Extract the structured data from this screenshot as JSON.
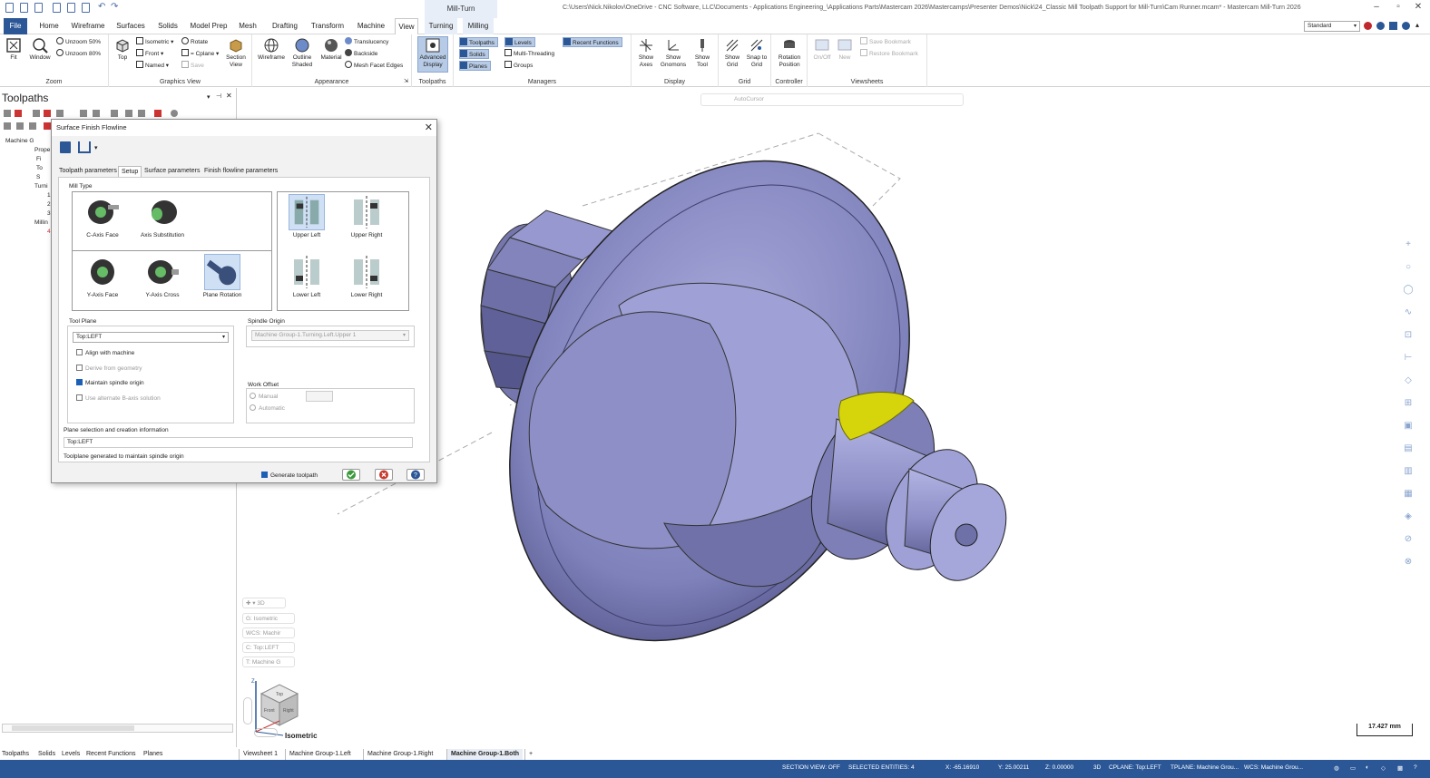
{
  "window": {
    "context_tab_label": "Mill-Turn",
    "title": "C:\\Users\\Nick.Nikolov\\OneDrive - CNC Software, LLC\\Documents - Applications Engineering_\\Applications Parts\\Mastercam 2026\\Mastercamps\\Presenter Demos\\Nick\\24_Classic Mill Toolpath Support for Mill-Turn\\Cam Runner.mcam* - Mastercam Mill-Turn 2026",
    "workspace": "Standard"
  },
  "ribbon_tabs": [
    "File",
    "Home",
    "Wireframe",
    "Surfaces",
    "Solids",
    "Model Prep",
    "Mesh",
    "Drafting",
    "Transform",
    "Machine",
    "View",
    "Turning",
    "Milling"
  ],
  "ribbon": {
    "zoom": {
      "label": "Zoom",
      "fit": "Fit",
      "window": "Window",
      "unzoom50": "Unzoom 50%",
      "unzoom80": "Unzoom 80%"
    },
    "graphics_view": {
      "label": "Graphics View",
      "top": "Top",
      "isometric": "Isometric",
      "front": "Front",
      "named": "Named",
      "rotate": "Rotate",
      "cplane": "= Cplane",
      "save": "Save",
      "section_view": "Section View"
    },
    "appearance": {
      "label": "Appearance",
      "wireframe": "Wireframe",
      "outline_shaded": "Outline Shaded",
      "material": "Material",
      "translucency": "Translucency",
      "backside": "Backside",
      "mesh_facet_edges": "Mesh Facet Edges"
    },
    "toolpaths": {
      "label": "Toolpaths",
      "advanced_display": "Advanced Display"
    },
    "managers": {
      "label": "Managers",
      "toolpaths": "Toolpaths",
      "solids": "Solids",
      "planes": "Planes",
      "levels": "Levels",
      "multi_threading": "Multi-Threading",
      "groups": "Groups",
      "recent_functions": "Recent Functions"
    },
    "display": {
      "label": "Display",
      "show_axes": "Show Axes",
      "show_gnomons": "Show Gnomons",
      "show_tool": "Show Tool"
    },
    "grid": {
      "label": "Grid",
      "show_grid": "Show Grid",
      "snap_to_grid": "Snap to Grid"
    },
    "controller": {
      "label": "Controller",
      "rotation_position": "Rotation Position"
    },
    "viewsheets": {
      "label": "Viewsheets",
      "onoff": "On/Off",
      "new": "New",
      "save_bookmark": "Save Bookmark",
      "restore_bookmark": "Restore Bookmark"
    }
  },
  "left_panel": {
    "title": "Toolpaths",
    "tree": [
      "Machine G",
      "Prope",
      "Fi",
      "To",
      "S",
      "Turni",
      "1",
      "2",
      "3",
      "Millin",
      "4"
    ]
  },
  "dialog": {
    "title": "Surface Finish Flowline",
    "tabs": [
      "Toolpath parameters",
      "Setup",
      "Surface parameters",
      "Finish flowline parameters"
    ],
    "active_tab": "Setup",
    "mill_type_label": "Mill Type",
    "mill_types": [
      "C-Axis Face",
      "Axis Substitution",
      "Y-Axis Face",
      "Y-Axis Cross",
      "Plane Rotation"
    ],
    "selected_mill_type": "Plane Rotation",
    "positions": [
      "Upper Left",
      "Upper Right",
      "Lower Left",
      "Lower Right"
    ],
    "selected_position": "Upper Left",
    "tool_plane_label": "Tool Plane",
    "tool_plane_value": "Top:LEFT",
    "align_with_machine": "Align with machine",
    "derive_from_geometry": "Derive from geometry",
    "maintain_spindle_origin": "Maintain spindle origin",
    "use_alternate_b_axis": "Use alternate B-axis solution",
    "spindle_origin_label": "Spindle Origin",
    "spindle_origin_value": "Machine Group-1.Turning.Left.Upper 1",
    "work_offset_label": "Work Offset",
    "manual": "Manual",
    "automatic": "Automatic",
    "plane_info_label": "Plane selection and creation information",
    "plane_info_value": "Top:LEFT",
    "plane_info_note": "Toolplane generated to maintain spindle origin",
    "generate_toolpath": "Generate toolpath"
  },
  "viewport": {
    "autocursor": "AutoCursor",
    "hud_3d": "3D",
    "hud_g": "G: Isometric",
    "hud_wcs": "WCS: Machir",
    "hud_c": "C: Top:LEFT",
    "hud_t": "T: Machine G",
    "view_name": "Isometric",
    "scale": "17.427 mm",
    "cube_faces": [
      "Top",
      "Front",
      "Right"
    ],
    "colors": {
      "part": "#8d8fc6",
      "highlight": "#d6d40a"
    }
  },
  "bottom_tabs": [
    "Toolpaths",
    "Solids",
    "Levels",
    "Recent Functions",
    "Planes"
  ],
  "viewsheets": [
    "Viewsheet 1",
    "Machine Group-1.Left",
    "Machine Group-1.Right",
    "Machine Group-1.Both"
  ],
  "viewsheet_add": "+",
  "status": {
    "section_view": "SECTION VIEW: OFF",
    "selected_entities": "SELECTED ENTITIES: 4",
    "x": "X:   -65.16910",
    "y": "Y:   25.00211",
    "z": "Z:   0.00000",
    "mode": "3D",
    "cplane": "CPLANE: Top:LEFT",
    "tplane": "TPLANE: Machine Grou...",
    "wcs": "WCS: Machine Grou..."
  }
}
